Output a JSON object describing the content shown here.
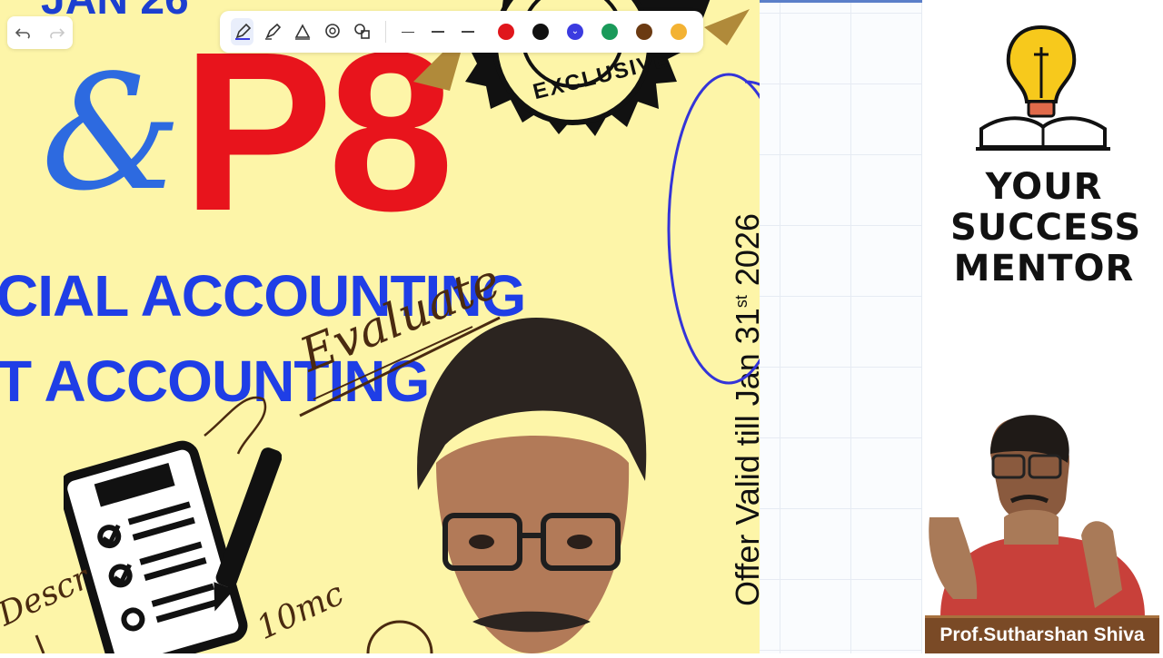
{
  "toolbar": {
    "undo_icon": "undo-icon",
    "redo_icon": "redo-icon",
    "tools": [
      "pen-tool-icon",
      "highlighter-tool-icon",
      "eraser-tool-icon",
      "lasso-tool-icon",
      "shapes-tool-icon"
    ],
    "line_widths": [
      "thin",
      "medium",
      "thick"
    ],
    "colors": [
      "#e0161c",
      "#111111",
      "#3b3be0",
      "#1a9a5a",
      "#6b3a12",
      "#f3b233"
    ],
    "selected_color": "#3b3be0"
  },
  "poster": {
    "header_fragment": "JAN 26",
    "ampersand": "&",
    "paper_code": "P8",
    "line1": "CIAL ACCOUNTING",
    "line2": "T ACCOUNTING",
    "badge_text": "EXCLUSIVE",
    "offer_text": "Offer Valid till Jan 31",
    "offer_suffix": "st",
    "offer_year": "2026"
  },
  "annotations": {
    "evaluate": "Evaluate",
    "describe": "Descr",
    "ten_marks": "10mc"
  },
  "brand": {
    "line1": "YOUR",
    "line2": "SUCCESS",
    "line3": "MENTOR"
  },
  "presenter": {
    "name": "Prof.Sutharshan Shiva"
  }
}
